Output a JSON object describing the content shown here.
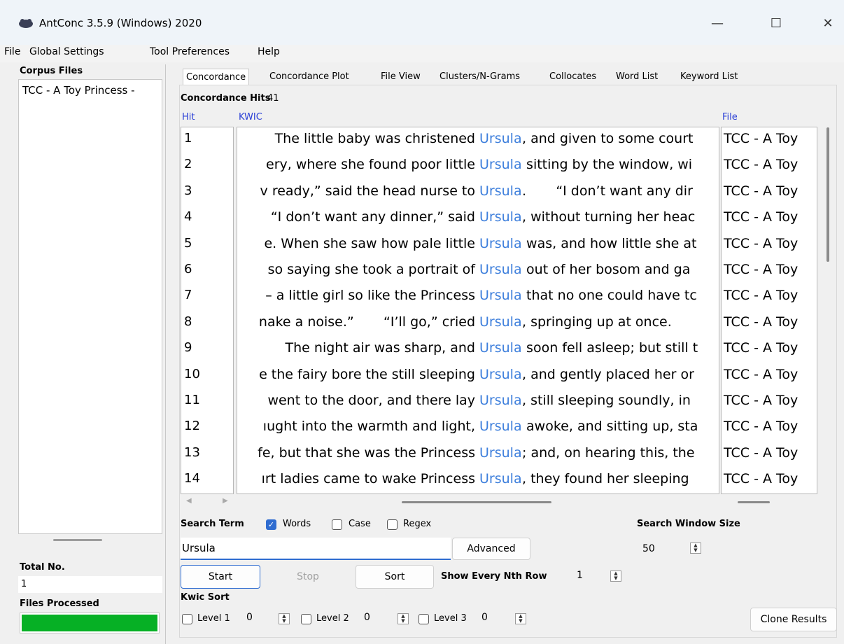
{
  "window": {
    "title": "AntConc 3.5.9 (Windows) 2020",
    "controls": [
      "—",
      "☐",
      "✕"
    ]
  },
  "menu": [
    "File",
    "Global Settings",
    "Tool Preferences",
    "Help"
  ],
  "left_panel": {
    "corpus_title": "Corpus Files",
    "files": [
      "TCC - A Toy Princess -"
    ],
    "total_label": "Total No.",
    "total_value": "1",
    "files_processed_label": "Files Processed",
    "progress": 1.0
  },
  "tabs": [
    "Concordance",
    "Concordance Plot",
    "File View",
    "Clusters/N-Grams",
    "Collocates",
    "Word List",
    "Keyword List"
  ],
  "active_tab": "Concordance",
  "concordance": {
    "hits_label": "Concordance Hits",
    "hits_count": "41",
    "columns": {
      "hit": "Hit",
      "kwic": "KWIC",
      "file": "File"
    },
    "rows": [
      {
        "n": "1",
        "left": "   The little baby was christened",
        "hit": "Ursula",
        "right": ", and given to some court",
        "file": "TCC - A Toy"
      },
      {
        "n": "2",
        "left": "ery, where she found poor little",
        "hit": "Ursula",
        "right": " sitting by the window, wi",
        "file": "TCC - A Toy"
      },
      {
        "n": "3",
        "left": "v ready,” said the head nurse to",
        "hit": "Ursula",
        "right": ".       “I don’t want any dir",
        "file": "TCC - A Toy"
      },
      {
        "n": "4",
        "left": "“I don’t want any dinner,” said",
        "hit": "Ursula",
        "right": ", without turning her heac",
        "file": "TCC - A Toy"
      },
      {
        "n": "5",
        "left": "e. When she saw how pale little",
        "hit": "Ursula",
        "right": " was, and how little she at",
        "file": "TCC - A Toy"
      },
      {
        "n": "6",
        "left": "so saying she took a portrait of",
        "hit": "Ursula",
        "right": " out of her bosom and ga",
        "file": "TCC - A Toy"
      },
      {
        "n": "7",
        "left": "– a little girl so like the Princess",
        "hit": "Ursula",
        "right": " that no one could have tc",
        "file": "TCC - A Toy"
      },
      {
        "n": "8",
        "left": "nake a noise.”       “I’ll go,” cried",
        "hit": "Ursula",
        "right": ", springing up at once.",
        "file": "TCC - A Toy"
      },
      {
        "n": "9",
        "left": "   The night air was sharp, and",
        "hit": "Ursula",
        "right": " soon fell asleep; but still t",
        "file": "TCC - A Toy"
      },
      {
        "n": "10",
        "left": "e the fairy bore the still sleeping",
        "hit": "Ursula",
        "right": ", and gently placed her or",
        "file": "TCC - A Toy"
      },
      {
        "n": "11",
        "left": "went to the door, and there lay",
        "hit": "Ursula",
        "right": ", still sleeping soundly, in",
        "file": "TCC - A Toy"
      },
      {
        "n": "12",
        "left": "ıught into the warmth and light,",
        "hit": "Ursula",
        "right": " awoke, and sitting up, sta",
        "file": "TCC - A Toy"
      },
      {
        "n": "13",
        "left": "fe, but that she was the Princess",
        "hit": "Ursula",
        "right": "; and, on hearing this, the",
        "file": "TCC - A Toy"
      },
      {
        "n": "14",
        "left": "ırt ladies came to wake Princess",
        "hit": "Ursula",
        "right": ", they found her sleeping",
        "file": "TCC - A Toy"
      }
    ]
  },
  "search": {
    "term_label": "Search Term",
    "words_label": "Words",
    "words_checked": true,
    "case_label": "Case",
    "case_checked": false,
    "regex_label": "Regex",
    "regex_checked": false,
    "value": "Ursula",
    "advanced_label": "Advanced",
    "window_size_label": "Search Window Size",
    "window_size_value": "50",
    "start_label": "Start",
    "stop_label": "Stop",
    "sort_label": "Sort",
    "nth_row_label": "Show Every Nth Row",
    "nth_row_value": "1"
  },
  "kwic_sort": {
    "title": "Kwic Sort",
    "levels": [
      {
        "label": "Level 1",
        "value": "0"
      },
      {
        "label": "Level 2",
        "value": "0"
      },
      {
        "label": "Level 3",
        "value": "0"
      }
    ],
    "clone_label": "Clone Results"
  }
}
